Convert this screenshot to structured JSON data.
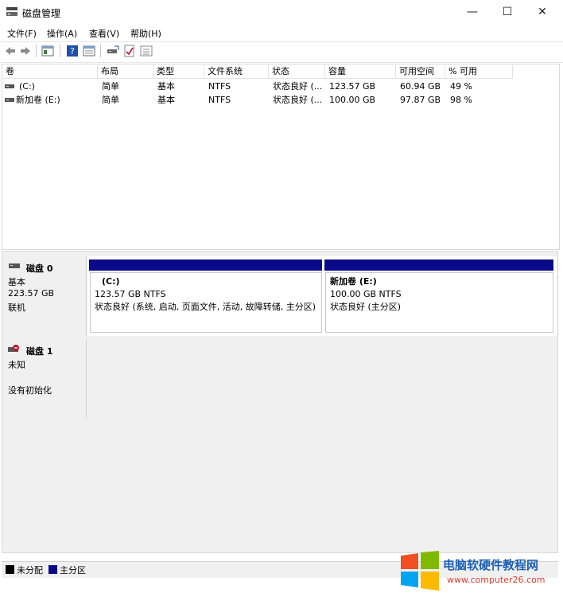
{
  "window": {
    "title": "磁盘管理",
    "minimize": "—",
    "maximize": "☐",
    "close": "✕"
  },
  "menu": [
    "文件(F)",
    "操作(A)",
    "查看(V)",
    "帮助(H)"
  ],
  "toolbar_icons": [
    "back-arrow-icon",
    "forward-arrow-icon",
    "console-tree-icon",
    "help-icon",
    "properties-icon",
    "disk-icon",
    "check-icon",
    "list-icon"
  ],
  "columns": [
    "卷",
    "布局",
    "类型",
    "文件系统",
    "状态",
    "容量",
    "可用空间",
    "% 可用"
  ],
  "volumes": [
    {
      "name": "(C:)",
      "layout": "简单",
      "type": "基本",
      "fs": "NTFS",
      "status": "状态良好 (...",
      "capacity": "123.57 GB",
      "free": "60.94 GB",
      "pct": "49 %"
    },
    {
      "name": "新加卷 (E:)",
      "layout": "简单",
      "type": "基本",
      "fs": "NTFS",
      "status": "状态良好 (...",
      "capacity": "100.00 GB",
      "free": "97.87 GB",
      "pct": "98 %"
    }
  ],
  "disks": [
    {
      "name": "磁盘 0",
      "type": "基本",
      "size": "223.57 GB",
      "state": "联机",
      "partitions": [
        {
          "label": "(C:)",
          "size": "123.57 GB NTFS",
          "status": "状态良好 (系统, 启动, 页面文件, 活动, 故障转储, 主分区)"
        },
        {
          "label": "新加卷 (E:)",
          "size": "100.00 GB NTFS",
          "status": "状态良好 (主分区)"
        }
      ]
    },
    {
      "name": "磁盘 1",
      "type": "未知",
      "state": "没有初始化"
    }
  ],
  "legend": [
    {
      "label": "未分配",
      "color": "#000000"
    },
    {
      "label": "主分区",
      "color": "#0a0a8a"
    }
  ],
  "watermark": {
    "title": "电脑软硬件教程网",
    "url": "www.computer26.com"
  },
  "colors": {
    "primary_partition": "#0a0a8a",
    "unallocated": "#000000",
    "disk_offline_badge": "#c0102a"
  }
}
